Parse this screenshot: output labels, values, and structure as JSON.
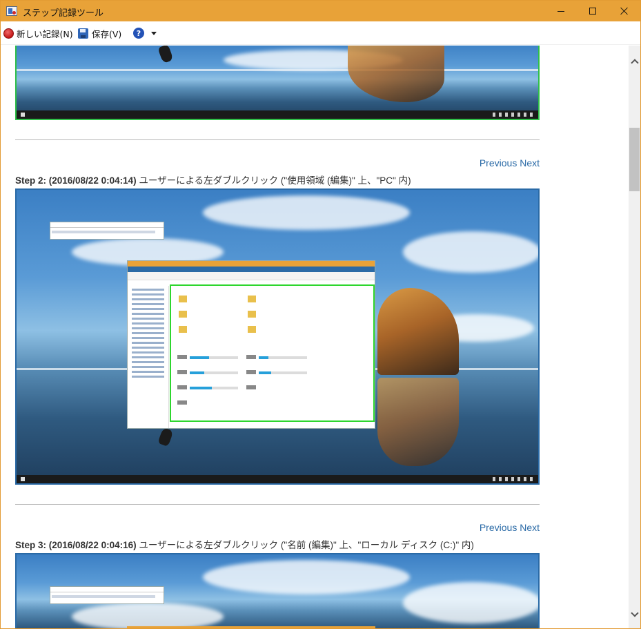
{
  "window": {
    "title": "ステップ記録ツール",
    "accent_color": "#e8a238"
  },
  "toolbar": {
    "new_record_label": "新しい記録(N)",
    "save_label": "保存(V)",
    "help_icon": "?"
  },
  "steps": [
    {
      "nav_previous": "Previous",
      "nav_next": "Next",
      "caption_prefix": "Step 2: (2016/08/22 0:04:14)",
      "caption_text": " ユーザーによる左ダブルクリック (\"使用領域 (編集)\" 上、\"PC\" 内)"
    },
    {
      "nav_previous": "Previous",
      "nav_next": "Next",
      "caption_prefix": "Step 3: (2016/08/22 0:04:16)",
      "caption_text": " ユーザーによる左ダブルクリック (\"名前 (編集)\" 上、\"ローカル ディスク (C:)\" 内)"
    }
  ],
  "colors": {
    "link": "#2a6aa6",
    "screenshot_border": "#2a6aa6",
    "highlight_border": "#2ed62e"
  }
}
